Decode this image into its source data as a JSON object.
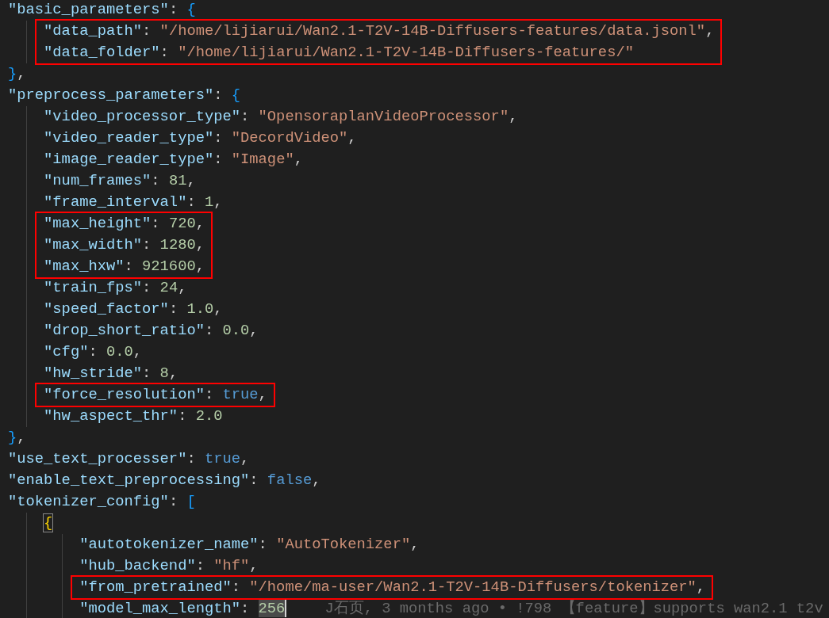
{
  "editor": {
    "lines": [
      {
        "tokens": [
          {
            "kind": "key",
            "text": "\"basic_parameters\""
          },
          {
            "kind": "punct",
            "text": ": "
          },
          {
            "kind": "bracket",
            "text": "{"
          }
        ],
        "children": [
          {
            "boxed": true,
            "tokens": [
              {
                "kind": "key",
                "text": "\"data_path\""
              },
              {
                "kind": "punct",
                "text": ": "
              },
              {
                "kind": "string",
                "text": "\"/home/lijiarui/Wan2.1-T2V-14B-Diffusers-features/data.jsonl\""
              },
              {
                "kind": "punct",
                "text": ","
              }
            ]
          },
          {
            "boxed": true,
            "tokens": [
              {
                "kind": "key",
                "text": "\"data_folder\""
              },
              {
                "kind": "punct",
                "text": ": "
              },
              {
                "kind": "string",
                "text": "\"/home/lijiarui/Wan2.1-T2V-14B-Diffusers-features/\""
              }
            ]
          }
        ]
      },
      {
        "tokens": [
          {
            "kind": "bracket",
            "text": "}"
          },
          {
            "kind": "punct",
            "text": ","
          }
        ]
      },
      {
        "tokens": [
          {
            "kind": "key",
            "text": "\"preprocess_parameters\""
          },
          {
            "kind": "punct",
            "text": ": "
          },
          {
            "kind": "bracket",
            "text": "{"
          }
        ],
        "children": [
          {
            "tokens": [
              {
                "kind": "key",
                "text": "\"video_processor_type\""
              },
              {
                "kind": "punct",
                "text": ": "
              },
              {
                "kind": "string",
                "text": "\"OpensoraplanVideoProcessor\""
              },
              {
                "kind": "punct",
                "text": ","
              }
            ]
          },
          {
            "tokens": [
              {
                "kind": "key",
                "text": "\"video_reader_type\""
              },
              {
                "kind": "punct",
                "text": ": "
              },
              {
                "kind": "string",
                "text": "\"DecordVideo\""
              },
              {
                "kind": "punct",
                "text": ","
              }
            ]
          },
          {
            "tokens": [
              {
                "kind": "key",
                "text": "\"image_reader_type\""
              },
              {
                "kind": "punct",
                "text": ": "
              },
              {
                "kind": "string",
                "text": "\"Image\""
              },
              {
                "kind": "punct",
                "text": ","
              }
            ]
          },
          {
            "tokens": [
              {
                "kind": "key",
                "text": "\"num_frames\""
              },
              {
                "kind": "punct",
                "text": ": "
              },
              {
                "kind": "number",
                "text": "81"
              },
              {
                "kind": "punct",
                "text": ","
              }
            ]
          },
          {
            "tokens": [
              {
                "kind": "key",
                "text": "\"frame_interval\""
              },
              {
                "kind": "punct",
                "text": ": "
              },
              {
                "kind": "number",
                "text": "1"
              },
              {
                "kind": "punct",
                "text": ","
              }
            ]
          },
          {
            "boxed": true,
            "tokens": [
              {
                "kind": "key",
                "text": "\"max_height\""
              },
              {
                "kind": "punct",
                "text": ": "
              },
              {
                "kind": "number",
                "text": "720"
              },
              {
                "kind": "punct",
                "text": ","
              }
            ]
          },
          {
            "boxed": true,
            "tokens": [
              {
                "kind": "key",
                "text": "\"max_width\""
              },
              {
                "kind": "punct",
                "text": ": "
              },
              {
                "kind": "number",
                "text": "1280"
              },
              {
                "kind": "punct",
                "text": ","
              }
            ]
          },
          {
            "boxed": true,
            "tokens": [
              {
                "kind": "key",
                "text": "\"max_hxw\""
              },
              {
                "kind": "punct",
                "text": ": "
              },
              {
                "kind": "number",
                "text": "921600"
              },
              {
                "kind": "punct",
                "text": ","
              }
            ]
          },
          {
            "tokens": [
              {
                "kind": "key",
                "text": "\"train_fps\""
              },
              {
                "kind": "punct",
                "text": ": "
              },
              {
                "kind": "number",
                "text": "24"
              },
              {
                "kind": "punct",
                "text": ","
              }
            ]
          },
          {
            "tokens": [
              {
                "kind": "key",
                "text": "\"speed_factor\""
              },
              {
                "kind": "punct",
                "text": ": "
              },
              {
                "kind": "number",
                "text": "1.0"
              },
              {
                "kind": "punct",
                "text": ","
              }
            ]
          },
          {
            "tokens": [
              {
                "kind": "key",
                "text": "\"drop_short_ratio\""
              },
              {
                "kind": "punct",
                "text": ": "
              },
              {
                "kind": "number",
                "text": "0.0"
              },
              {
                "kind": "punct",
                "text": ","
              }
            ]
          },
          {
            "tokens": [
              {
                "kind": "key",
                "text": "\"cfg\""
              },
              {
                "kind": "punct",
                "text": ": "
              },
              {
                "kind": "number",
                "text": "0.0"
              },
              {
                "kind": "punct",
                "text": ","
              }
            ]
          },
          {
            "tokens": [
              {
                "kind": "key",
                "text": "\"hw_stride\""
              },
              {
                "kind": "punct",
                "text": ": "
              },
              {
                "kind": "number",
                "text": "8"
              },
              {
                "kind": "punct",
                "text": ","
              }
            ]
          },
          {
            "boxed": true,
            "tokens": [
              {
                "kind": "key",
                "text": "\"force_resolution\""
              },
              {
                "kind": "punct",
                "text": ": "
              },
              {
                "kind": "bool",
                "text": "true"
              },
              {
                "kind": "punct",
                "text": ","
              }
            ]
          },
          {
            "tokens": [
              {
                "kind": "key",
                "text": "\"hw_aspect_thr\""
              },
              {
                "kind": "punct",
                "text": ": "
              },
              {
                "kind": "number",
                "text": "2.0"
              }
            ]
          }
        ]
      },
      {
        "tokens": [
          {
            "kind": "bracket",
            "text": "}"
          },
          {
            "kind": "punct",
            "text": ","
          }
        ]
      },
      {
        "tokens": [
          {
            "kind": "key",
            "text": "\"use_text_processer\""
          },
          {
            "kind": "punct",
            "text": ": "
          },
          {
            "kind": "bool",
            "text": "true"
          },
          {
            "kind": "punct",
            "text": ","
          }
        ]
      },
      {
        "tokens": [
          {
            "kind": "key",
            "text": "\"enable_text_preprocessing\""
          },
          {
            "kind": "punct",
            "text": ": "
          },
          {
            "kind": "bool",
            "text": "false"
          },
          {
            "kind": "punct",
            "text": ","
          }
        ]
      },
      {
        "tokens": [
          {
            "kind": "key",
            "text": "\"tokenizer_config\""
          },
          {
            "kind": "punct",
            "text": ": "
          },
          {
            "kind": "bracket",
            "text": "["
          }
        ],
        "children": [
          {
            "tokens": [
              {
                "kind": "bracket_match",
                "text": "{"
              }
            ],
            "children": [
              {
                "tokens": [
                  {
                    "kind": "key",
                    "text": "\"autotokenizer_name\""
                  },
                  {
                    "kind": "punct",
                    "text": ": "
                  },
                  {
                    "kind": "string",
                    "text": "\"AutoTokenizer\""
                  },
                  {
                    "kind": "punct",
                    "text": ","
                  }
                ]
              },
              {
                "tokens": [
                  {
                    "kind": "key",
                    "text": "\"hub_backend\""
                  },
                  {
                    "kind": "punct",
                    "text": ": "
                  },
                  {
                    "kind": "string",
                    "text": "\"hf\""
                  },
                  {
                    "kind": "punct",
                    "text": ","
                  }
                ]
              },
              {
                "boxed": true,
                "tokens": [
                  {
                    "kind": "key",
                    "text": "\"from_pretrained\""
                  },
                  {
                    "kind": "punct",
                    "text": ": "
                  },
                  {
                    "kind": "string",
                    "text": "\"/home/ma-user/Wan2.1-T2V-14B-Diffusers/tokenizer\""
                  },
                  {
                    "kind": "punct",
                    "text": ","
                  }
                ]
              },
              {
                "tokens": [
                  {
                    "kind": "key",
                    "text": "\"model_max_length\""
                  },
                  {
                    "kind": "punct",
                    "text": ": "
                  },
                  {
                    "kind": "number_selected",
                    "text": "256"
                  },
                  {
                    "kind": "blame",
                    "text": "J石页, 3 months ago • !798 【feature】supports wan2.1 t2v"
                  }
                ]
              }
            ]
          }
        ]
      }
    ]
  }
}
